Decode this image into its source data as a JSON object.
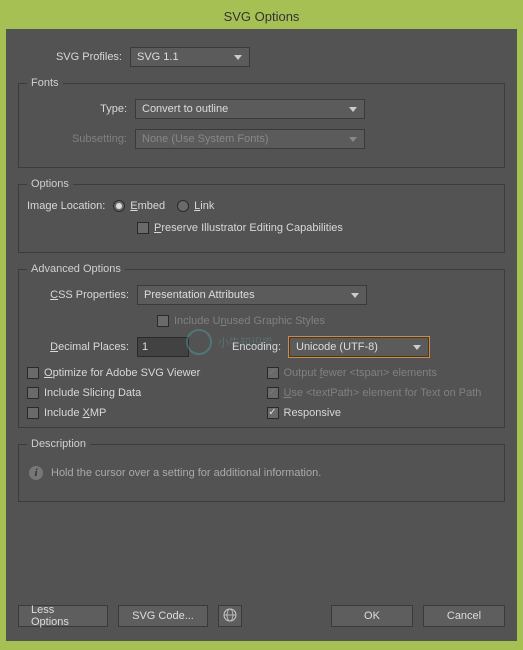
{
  "title": "SVG Options",
  "profiles": {
    "label": "SVG Profiles:",
    "value": "SVG 1.1"
  },
  "fonts": {
    "legend": "Fonts",
    "type": {
      "label": "Type:",
      "value": "Convert to outline"
    },
    "subsetting": {
      "label": "Subsetting:",
      "value": "None (Use System Fonts)"
    }
  },
  "options": {
    "legend": "Options",
    "imageLocation": {
      "label": "Image Location:",
      "embed": "Embed",
      "link": "Link"
    },
    "preserve": "Preserve Illustrator Editing Capabilities"
  },
  "advanced": {
    "legend": "Advanced Options",
    "css": {
      "label": "CSS Properties:",
      "value": "Presentation Attributes"
    },
    "unused": "Include Unused Graphic Styles",
    "decimal": {
      "label": "Decimal Places:",
      "value": "1"
    },
    "encoding": {
      "label": "Encoding:",
      "value": "Unicode (UTF-8)"
    },
    "optimize": "Optimize for Adobe SVG Viewer",
    "outputFewer": "Output fewer <tspan> elements",
    "slicing": "Include Slicing Data",
    "textpath": "Use <textPath> element for Text on Path",
    "xmp": "Include XMP",
    "responsive": "Responsive"
  },
  "description": {
    "legend": "Description",
    "text": "Hold the cursor over a setting for additional information."
  },
  "buttons": {
    "less": "Less Options",
    "svgcode": "SVG Code...",
    "ok": "OK",
    "cancel": "Cancel"
  },
  "watermark": "小牛知识库"
}
